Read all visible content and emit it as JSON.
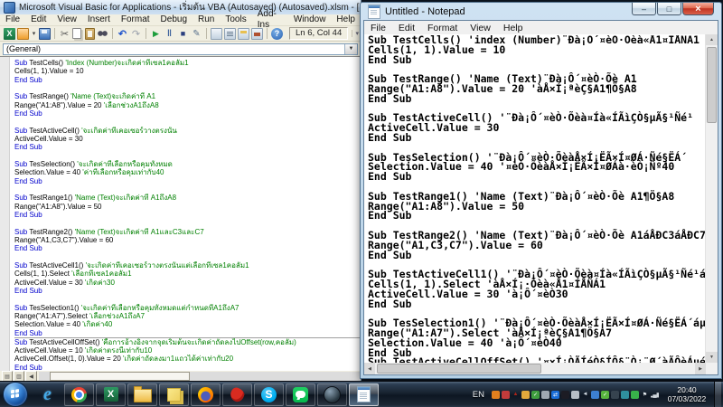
{
  "vba": {
    "title": "Microsoft Visual Basic for Applications - เริ่มต้น VBA (Autosaved) (Autosaved).xlsm - [Sheet1 (Code)]",
    "menu": [
      "File",
      "Edit",
      "View",
      "Insert",
      "Format",
      "Debug",
      "Run",
      "Tools",
      "Add-Ins",
      "Window",
      "Help"
    ],
    "toolbar_icons": [
      "view-excel",
      "insert-object",
      "insert-object-caret",
      "save",
      "|",
      "cut",
      "copy",
      "paste",
      "find",
      "|",
      "undo",
      "redo",
      "|",
      "run",
      "break",
      "reset",
      "design-mode",
      "|",
      "project-explorer",
      "properties-window",
      "object-browser",
      "toolbox",
      "|",
      "help"
    ],
    "position_indicator": "Ln 6, Col 44",
    "object_combo": "(General)",
    "code_lines": [
      {
        "segs": [
          [
            "Sub ",
            "k"
          ],
          [
            "TestCells() ",
            "p"
          ],
          [
            "'Index (Number)จะเกิดค่าที่เซล1คอลัม1",
            "c"
          ]
        ]
      },
      {
        "segs": [
          [
            "Cells(1, 1).Value = 10",
            "p"
          ]
        ]
      },
      {
        "segs": [
          [
            "End Sub",
            "k"
          ]
        ]
      },
      {
        "segs": []
      },
      {
        "segs": [
          [
            "Sub ",
            "k"
          ],
          [
            "TestRange() ",
            "p"
          ],
          [
            "'Name (Text)จะเกิดค่าที่ A1",
            "c"
          ]
        ]
      },
      {
        "segs": [
          [
            "Range(\"A1:A8\").Value = 20 ",
            "p"
          ],
          [
            "'เลือกช่วงA1ถึงA8",
            "c"
          ]
        ]
      },
      {
        "segs": [
          [
            "End Sub",
            "k"
          ]
        ]
      },
      {
        "segs": []
      },
      {
        "segs": [
          [
            "Sub ",
            "k"
          ],
          [
            "TestActiveCell() ",
            "p"
          ],
          [
            "'จะเกิดค่าที่เคอเซอร์วางตรงนั้น",
            "c"
          ]
        ]
      },
      {
        "segs": [
          [
            "ActiveCell.Value = 30",
            "p"
          ]
        ]
      },
      {
        "segs": [
          [
            "End Sub",
            "k"
          ]
        ]
      },
      {
        "segs": []
      },
      {
        "segs": [
          [
            "Sub ",
            "k"
          ],
          [
            "TesSelection() ",
            "p"
          ],
          [
            "'จะเกิดค่าที่เลือกหรือคุมทั้งหมด",
            "c"
          ]
        ]
      },
      {
        "segs": [
          [
            "Selection.Value = 40 ",
            "p"
          ],
          [
            "'ค่าที่เลือกหรือคุมเท่ากับ40",
            "c"
          ]
        ]
      },
      {
        "segs": [
          [
            "End Sub",
            "k"
          ]
        ]
      },
      {
        "segs": []
      },
      {
        "segs": [
          [
            "Sub ",
            "k"
          ],
          [
            "TestRange1() ",
            "p"
          ],
          [
            "'Name (Text)จะเกิดค่าที่ A1ถึงA8",
            "c"
          ]
        ]
      },
      {
        "segs": [
          [
            "Range(\"A1:A8\").Value = 50",
            "p"
          ]
        ]
      },
      {
        "segs": [
          [
            "End Sub",
            "k"
          ]
        ]
      },
      {
        "segs": []
      },
      {
        "segs": [
          [
            "Sub ",
            "k"
          ],
          [
            "TestRange2() ",
            "p"
          ],
          [
            "'Name (Text)จะเกิดค่าที่ A1และC3และC7",
            "c"
          ]
        ]
      },
      {
        "segs": [
          [
            "Range(\"A1,C3,C7\").Value = 60",
            "p"
          ]
        ]
      },
      {
        "segs": [
          [
            "End Sub",
            "k"
          ]
        ]
      },
      {
        "segs": []
      },
      {
        "segs": [
          [
            "Sub ",
            "k"
          ],
          [
            "TestActiveCell1() ",
            "p"
          ],
          [
            "'จะเกิดค่าที่เคอเซอร์วางตรงนั้นแต่เลือกที่เซล1คอลัม1",
            "c"
          ]
        ]
      },
      {
        "segs": [
          [
            "Cells(1, 1).Select ",
            "p"
          ],
          [
            "'เลือกที่เซล1คอลัม1",
            "c"
          ]
        ]
      },
      {
        "segs": [
          [
            "ActiveCell.Value = 30 ",
            "p"
          ],
          [
            "'เกิดค่า30",
            "c"
          ]
        ]
      },
      {
        "segs": [
          [
            "End Sub",
            "k"
          ]
        ]
      },
      {
        "segs": []
      },
      {
        "segs": [
          [
            "Sub ",
            "k"
          ],
          [
            "TesSelection1() ",
            "p"
          ],
          [
            "'จะเกิดค่าที่เลือกหรือคุมทั้งหมดแต่กำหนดที่A1ถึงA7",
            "c"
          ]
        ]
      },
      {
        "segs": [
          [
            "Range(\"A1:A7\").Select ",
            "p"
          ],
          [
            "'เลือกช่วงA1ถึงA7",
            "c"
          ]
        ]
      },
      {
        "segs": [
          [
            "Selection.Value = 40 ",
            "p"
          ],
          [
            "'เกิดค่า40",
            "c"
          ]
        ]
      },
      {
        "segs": [
          [
            "End Sub",
            "k"
          ]
        ]
      },
      {
        "segs": [
          [
            "Sub ",
            "k"
          ],
          [
            "TestActiveCellOffSet() ",
            "p"
          ],
          [
            "'คือการอ้างอิงจากจุดเริ่มต้นจะเกิดค่าถัดลงไปOffset(row,คอลัม)",
            "c"
          ]
        ],
        "sep": true
      },
      {
        "segs": [
          [
            "ActiveCell.Value = 10 ",
            "p"
          ],
          [
            "'เกิดค่าตรงนี้เท่ากับ10",
            "c"
          ]
        ]
      },
      {
        "segs": [
          [
            "ActiveCell.Offset(1, 0).Value = 20 ",
            "p"
          ],
          [
            "'เกิดค่าถัดลงมา1แถวได้ค่าเท่ากับ20",
            "c"
          ]
        ]
      },
      {
        "segs": [
          [
            "End Sub",
            "k"
          ]
        ]
      }
    ]
  },
  "notepad": {
    "title": "Untitled - Notepad",
    "menu": [
      "File",
      "Edit",
      "Format",
      "View",
      "Help"
    ],
    "window_controls": {
      "minimize": "–",
      "maximize": "□",
      "close": "×"
    },
    "lines": [
      "Sub TestCells() 'index (Number)¨Ðà¡Ô´¤èÒ·Õèà«Å1¤ÍÅÑÁ1",
      "Cells(1, 1).Value = 10",
      "End Sub",
      "",
      "Sub TestRange() 'Name (Text)¨Ðà¡Ô´¤èÒ·Õè A1",
      "Range(\"A1:A8\").Value = 20 'àÅ×Í¡ªèÇ§A1¶Ö§A8",
      "End Sub",
      "",
      "Sub TestActiveCell() '¨Ðà¡Ô´¤èÒ·Õèà¤Íà«ÍÃìÇÒ§µÃ§¹Ñé¹",
      "ActiveCell.Value = 30",
      "End Sub",
      "",
      "Sub TesSelection() '¨Ðà¡Ô´¤èÒ·ÕèàÅ×Í¡ËÃ×Í¤ØÁ·Ñé§ËÁ´",
      "Selection.Value = 40 '¤èÒ·ÕèàÅ×Í¡ËÃ×Í¤ØÁà·èÒ¡Ñº40",
      "End Sub",
      "",
      "Sub TestRange1() 'Name (Text)¨Ðà¡Ô´¤èÒ·Õè A1¶Ö§A8",
      "Range(\"A1:A8\").Value = 50",
      "End Sub",
      "",
      "Sub TestRange2() 'Name (Text)¨Ðà¡Ô´¤èÒ·Õè A1áÅÐC3áÅÐC7",
      "Range(\"A1,C3,C7\").Value = 60",
      "End Sub",
      "",
      "Sub TestActiveCell1() '¨Ðà¡Ô´¤èÒ·Õèà¤Íà«ÍÃìÇÒ§µÃ§¹Ñé¹á",
      "Cells(1, 1).Select 'àÅ×Í¡·Õèà«Å1¤ÍÅÑÁ1",
      "ActiveCell.Value = 30 'à¡Ô´¤èÒ30",
      "End Sub",
      "",
      "Sub TesSelection1() '¨Ðà¡Ô´¤èÒ·ÕèàÅ×Í¡ËÃ×Í¤ØÁ·Ñé§ËÁ´áµ",
      "Range(\"A1:A7\").Select 'àÅ×Í¡ªèÇ§A1¶Ö§A7",
      "Selection.Value = 40 'à¡Ô´¤èÒ40",
      "End Sub",
      "Sub TestActiveCellOffSet() '¤×Í¡ÒÃÍéÒ§ÍÔ§¨Ò¡¨Ø´àÃÔèÁµé"
    ]
  },
  "taskbar": {
    "apps": [
      {
        "name": "internet-explorer",
        "boxed": false,
        "active": false
      },
      {
        "name": "chrome",
        "boxed": true,
        "active": false
      },
      {
        "name": "excel",
        "boxed": true,
        "active": false
      },
      {
        "name": "windows-explorer",
        "boxed": true,
        "active": false
      },
      {
        "name": "sticky-notes",
        "boxed": true,
        "active": false
      },
      {
        "name": "firefox",
        "boxed": true,
        "active": false
      },
      {
        "name": "red-app",
        "boxed": true,
        "active": false
      },
      {
        "name": "skype",
        "boxed": true,
        "active": false
      },
      {
        "name": "line",
        "boxed": true,
        "active": false
      },
      {
        "name": "security-app",
        "boxed": true,
        "active": false
      },
      {
        "name": "notepad",
        "boxed": true,
        "active": true
      }
    ],
    "language": "EN",
    "tray_icons": [
      {
        "name": "tray-orange-app",
        "color": "#e2801e",
        "glyph": ""
      },
      {
        "name": "tray-red-shield",
        "color": "#c23b3b",
        "glyph": ""
      },
      {
        "name": "tray-red-triangle",
        "color": "transparent",
        "fg": "#b02418",
        "glyph": "▲"
      },
      {
        "name": "tray-folder",
        "color": "#e2a93c",
        "glyph": ""
      },
      {
        "name": "tray-green-shield",
        "color": "#3f9e3f",
        "fg": "#ffffff",
        "glyph": "✓"
      },
      {
        "name": "tray-monitor",
        "color": "#9fa8b2",
        "glyph": ""
      },
      {
        "name": "tray-teamviewer",
        "color": "#1a6ed8",
        "fg": "#ffffff",
        "glyph": "⇄"
      },
      {
        "name": "tray-media-app",
        "color": "#1c1c24",
        "fg": "#d03030",
        "glyph": ""
      },
      {
        "name": "tray-clipboard",
        "color": "#b6bec6",
        "glyph": ""
      },
      {
        "name": "tray-speaker",
        "color": "transparent",
        "fg": "#d8e0e8",
        "glyph": "◄"
      },
      {
        "name": "tray-network",
        "color": "#3c7fd0",
        "glyph": ""
      },
      {
        "name": "tray-update-ok",
        "color": "#57b33e",
        "fg": "#ffffff",
        "glyph": "✓"
      },
      {
        "name": "tray-sphere",
        "color": "#36434f",
        "glyph": ""
      },
      {
        "name": "tray-globe",
        "color": "#2f8f9e",
        "glyph": ""
      },
      {
        "name": "tray-messenger",
        "color": "#38b24a",
        "glyph": ""
      },
      {
        "name": "tray-flag",
        "color": "transparent",
        "fg": "#e8eef2",
        "glyph": "⚑"
      },
      {
        "name": "tray-signal",
        "color": "transparent",
        "fg": "#cfd6dc",
        "glyph": "▂▄▆"
      }
    ],
    "clock": {
      "time": "20:40",
      "date": "07/03/2022"
    }
  }
}
